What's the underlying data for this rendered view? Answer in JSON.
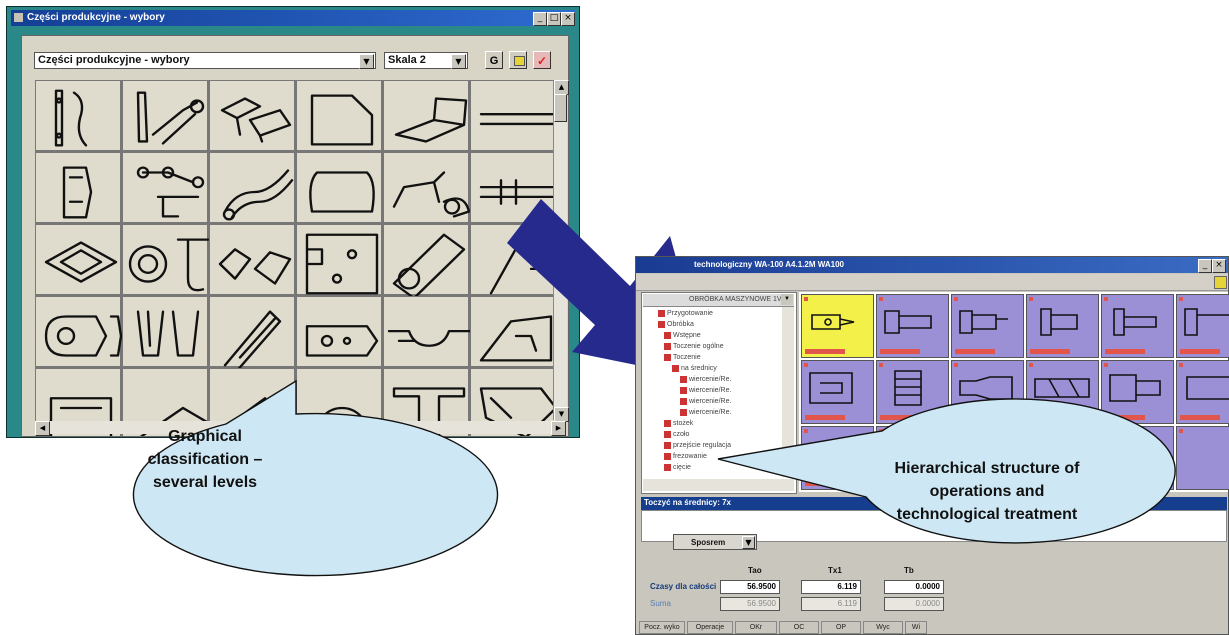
{
  "colors": {
    "arrow": "#252a8c",
    "callout_fill": "#cde8f4",
    "window_frame": "#2a8888",
    "selected_operation": "#f3f04a",
    "operation_tile": "#9b90d6"
  },
  "catalog_window": {
    "title": "Części produkcyjne - wybory",
    "title_buttons": [
      "_",
      "□",
      "×"
    ],
    "category_select": "Części produkcyjne - wybory",
    "scale_select": "Skala 2",
    "btn_g": "G",
    "btn_tool_icon": "folder-icon",
    "btn_ok_icon": "check-icon",
    "grid_icons": [
      "bracket-part-icon",
      "lever-part-icon",
      "channel-part-icon",
      "plate-polygon-icon",
      "angle-part-icon",
      "bar-part-icon",
      "housing-part-icon",
      "linkage-part-icon",
      "bent-tube-icon",
      "frame-part-icon",
      "clip-part-icon",
      "pin-part-icon",
      "grid-plate-icon",
      "flange-hook-icon",
      "profile-part-icon",
      "holed-plate-icon",
      "tube-part-icon",
      "cone-part-icon",
      "ring-part-icon",
      "fork-part-icon",
      "rod-part-icon",
      "slot-plate-icon",
      "beam-part-icon",
      "gusset-part-icon",
      "frame-bottom-icon",
      "strip-bottom-icon",
      "wedge-bottom-icon",
      "disc-bottom-icon",
      "tee-bottom-icon",
      "cast-bottom-icon"
    ]
  },
  "tech_window": {
    "title": "technologiczny  WA-100 A4.1.2M WA100",
    "tree_header": "OBRÓBKA MASZYNOWE 1V",
    "tree_items": [
      "Przygotowanie",
      "Obróbka",
      "Wstępne",
      "Toczenie ogólne",
      "Toczenie",
      "na średnicy",
      "wiercenie/Re.",
      "wiercenie/Re.",
      "wiercenie/Re.",
      "wiercenie/Re.",
      "stożek",
      "czoło",
      "przejście regulacja",
      "frezowanie",
      "cięcie"
    ],
    "operation_icons": [
      "turning-tool-icon",
      "shaft-op-icon",
      "shaft-op-icon",
      "facing-op-icon",
      "facing-op-icon",
      "shaft-op-icon",
      "block-op-icon",
      "chuck-op-icon",
      "taper-op-icon",
      "boring-op-icon",
      "step-op-icon",
      "cut-op-icon",
      "groove-op-icon",
      "bore-op-icon",
      "face-op-icon"
    ],
    "operation_detail_title": "Toczyć na średnicy: 7x",
    "method_select": "Sposrem",
    "col_headers": [
      "Tao",
      "Tx1",
      "Tb"
    ],
    "row1_label": "Czasy dla całości",
    "row1_values": [
      "56.9500",
      "6.119",
      "0.0000"
    ],
    "row2_label": "Suma",
    "row2_values": [
      "56.9500",
      "6.119",
      "0.0000"
    ],
    "status_buttons": [
      "Pocz. wyko",
      "Operacje",
      "OKr",
      "OC",
      "OP",
      "Wyc",
      "Wi"
    ]
  },
  "callouts": {
    "left": "Graphical classification – several levels",
    "left_lines": [
      "Graphical",
      "classification –",
      "several levels"
    ],
    "right": "Hierarchical structure of operations and technological treatment",
    "right_lines": [
      "Hierarchical structure of",
      "operations and",
      "technological treatment"
    ]
  }
}
